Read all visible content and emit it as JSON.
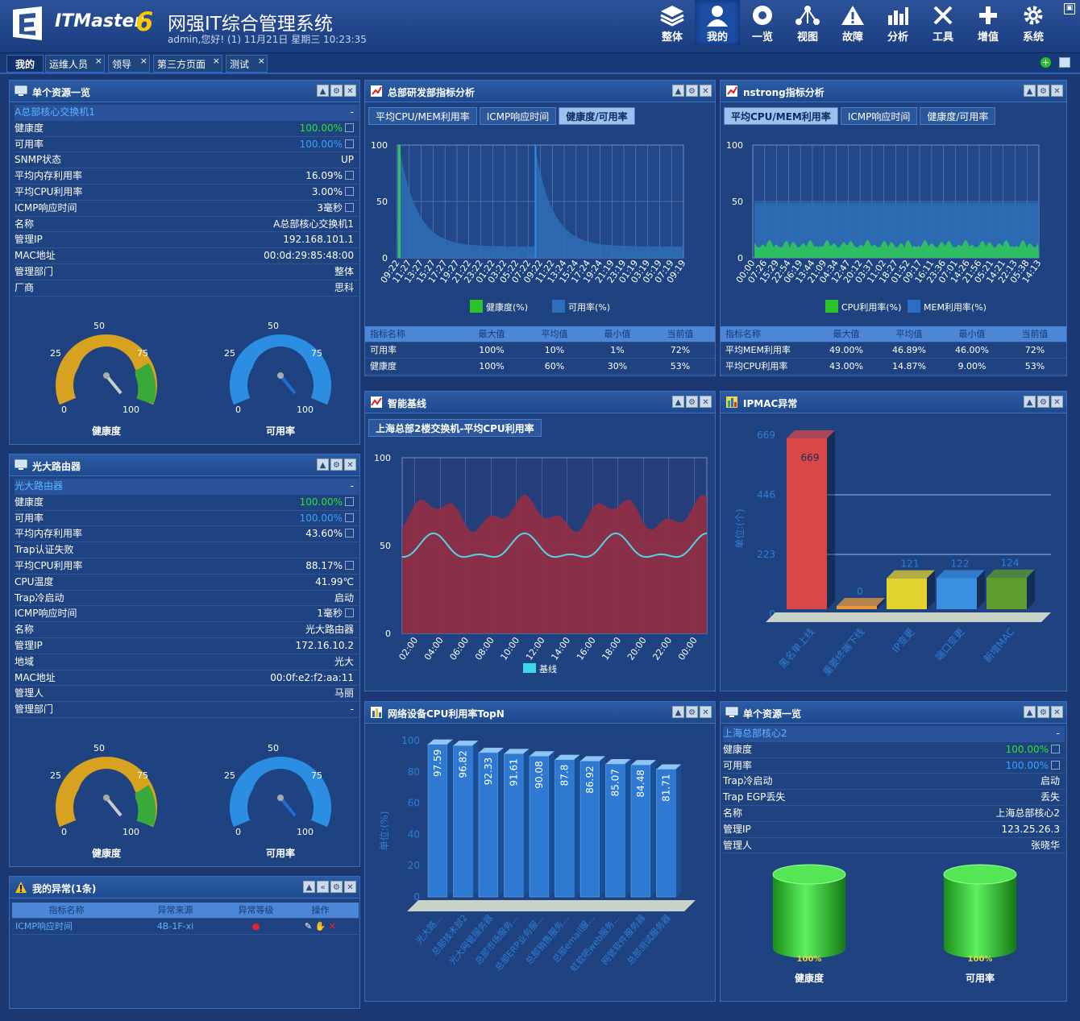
{
  "header": {
    "logo_text": "ITMaster",
    "logo_version": "6",
    "title": "网强IT综合管理系统",
    "user_info": "admin,您好! (1) 11月21日 星期三 10:23:35",
    "nav": [
      {
        "label": "整体",
        "icon": "layers-icon"
      },
      {
        "label": "我的",
        "icon": "user-icon"
      },
      {
        "label": "一览",
        "icon": "overview-icon"
      },
      {
        "label": "视图",
        "icon": "topology-icon"
      },
      {
        "label": "故障",
        "icon": "warning-icon"
      },
      {
        "label": "分析",
        "icon": "chart-icon"
      },
      {
        "label": "工具",
        "icon": "tools-icon"
      },
      {
        "label": "增值",
        "icon": "plus-icon"
      },
      {
        "label": "系统",
        "icon": "gear-icon"
      }
    ]
  },
  "tabs": [
    {
      "label": "我的",
      "active": true
    },
    {
      "label": "运维人员"
    },
    {
      "label": "领导"
    },
    {
      "label": "第三方页面"
    },
    {
      "label": "测试"
    }
  ],
  "panel1": {
    "title": "单个资源一览",
    "device": "A总部核心交换机1",
    "device_val": "-",
    "rows": [
      [
        "健康度",
        "100.00%"
      ],
      [
        "可用率",
        "100.00%"
      ],
      [
        "SNMP状态",
        "UP"
      ],
      [
        "平均内存利用率",
        "16.09%"
      ],
      [
        "平均CPU利用率",
        "3.00%"
      ],
      [
        "ICMP响应时间",
        "3毫秒"
      ],
      [
        "名称",
        "A总部核心交换机1"
      ],
      [
        "管理IP",
        "192.168.101.1"
      ],
      [
        "MAC地址",
        "00:0d:29:85:48:00"
      ],
      [
        "管理部门",
        "整体"
      ],
      [
        "厂商",
        "思科"
      ]
    ],
    "g1_label": "健康度",
    "g2_label": "可用率"
  },
  "panel2": {
    "title": "光大路由器",
    "device": "光大路由器",
    "device_val": "-",
    "rows": [
      [
        "健康度",
        "100.00%"
      ],
      [
        "可用率",
        "100.00%"
      ],
      [
        "平均内存利用率",
        "43.60%"
      ],
      [
        "Trap认证失败",
        ""
      ],
      [
        "平均CPU利用率",
        "88.17%"
      ],
      [
        "CPU温度",
        "41.99℃"
      ],
      [
        "Trap冷启动",
        "启动"
      ],
      [
        "ICMP响应时间",
        "1毫秒"
      ],
      [
        "名称",
        "光大路由器"
      ],
      [
        "管理IP",
        "172.16.10.2"
      ],
      [
        "地域",
        "光大"
      ],
      [
        "MAC地址",
        "00:0f:e2:f2:aa:11"
      ],
      [
        "管理人",
        "马丽"
      ],
      [
        "管理部门",
        "-"
      ]
    ],
    "g1_label": "健康度",
    "g2_label": "可用率"
  },
  "gauge_ticks": [
    "0",
    "25",
    "50",
    "75",
    "100"
  ],
  "panel3": {
    "title": "我的异常(1条)",
    "cols": [
      "指标名称",
      "异常来源",
      "异常等级",
      "操作"
    ],
    "row": [
      "ICMP响应时间",
      "4B-1F-xi"
    ]
  },
  "panel4": {
    "title": "总部研发部指标分析",
    "tabs": [
      "平均CPU/MEM利用率",
      "ICMP响应时间",
      "健康度/可用率"
    ],
    "x_labels": [
      "09:22",
      "11:27",
      "13:27",
      "15:27",
      "17:27",
      "19:27",
      "21:22",
      "23:22",
      "01:22",
      "03:22",
      "05:22",
      "07:22",
      "09:22",
      "11:22",
      "13:24",
      "15:24",
      "17:24",
      "19:24",
      "21:19",
      "23:19",
      "01:19",
      "03:19",
      "05:19",
      "07:19",
      "09:19"
    ],
    "y_ticks": [
      "100",
      "50",
      "0"
    ],
    "legend": [
      "健康度(%)",
      "可用率(%)"
    ],
    "cols": [
      "指标名称",
      "最大值",
      "平均值",
      "最小值",
      "当前值"
    ],
    "rows": [
      [
        "可用率",
        "100%",
        "10%",
        "1%",
        "72%"
      ],
      [
        "健康度",
        "100%",
        "60%",
        "30%",
        "53%"
      ]
    ]
  },
  "panel5": {
    "title": "nstrong指标分析",
    "tabs": [
      "平均CPU/MEM利用率",
      "ICMP响应时间",
      "健康度/可用率"
    ],
    "x_labels": [
      "00:00",
      "07:26",
      "15:29",
      "22:54",
      "06:19",
      "13:44",
      "21:09",
      "04:34",
      "12:47",
      "20:12",
      "03:37",
      "11:02",
      "18:27",
      "01:52",
      "09:17",
      "16:11",
      "23:36",
      "07:01",
      "14:26",
      "21:56",
      "05:21",
      "14:21",
      "22:13",
      "05:38",
      "14:13"
    ],
    "y_ticks": [
      "100",
      "50",
      "0"
    ],
    "legend": [
      "CPU利用率(%)",
      "MEM利用率(%)"
    ],
    "cols": [
      "指标名称",
      "最大值",
      "平均值",
      "最小值",
      "当前值"
    ],
    "rows": [
      [
        "平均MEM利用率",
        "49.00%",
        "46.89%",
        "46.00%",
        "72%"
      ],
      [
        "平均CPU利用率",
        "43.00%",
        "14.87%",
        "9.00%",
        "53%"
      ]
    ]
  },
  "panel6": {
    "title": "智能基线",
    "tab": "上海总部2楼交换机-平均CPU利用率",
    "x_labels": [
      "02:00",
      "04:00",
      "06:00",
      "08:00",
      "10:00",
      "12:00",
      "14:00",
      "16:00",
      "18:00",
      "20:00",
      "22:00",
      "00:00"
    ],
    "y_ticks": [
      "100",
      "50",
      "0"
    ],
    "legend": "基线"
  },
  "panel7": {
    "title": "IPMAC异常",
    "ylabel": "单位:(个)",
    "y_ticks": [
      "669",
      "446",
      "223",
      "0"
    ],
    "categories": [
      "黑名单上线",
      "重要终端下线",
      "IP变更",
      "端口变更",
      "新增MAC"
    ],
    "values": [
      669,
      0,
      121,
      122,
      124
    ],
    "colors": [
      "#d84848",
      "#e89a3a",
      "#e2d22d",
      "#3a8fe0",
      "#5d9c2d"
    ]
  },
  "panel8": {
    "title": "网络设备CPU利用率TopN",
    "ylabel": "单位:(%)",
    "y_ticks": [
      "100",
      "80",
      "60",
      "40",
      "20",
      "0"
    ],
    "categories": [
      "光大路...",
      "总部技术部2",
      "光大网管服务器",
      "总部市场服务...",
      "总部ERP业务服...",
      "总部销售服务...",
      "总部email服...",
      "虹软吧web服务...",
      "网管软件服务器",
      "总部测试服务器"
    ],
    "values": [
      97.59,
      96.82,
      92.33,
      91.61,
      90.08,
      87.8,
      86.92,
      85.07,
      84.48,
      81.71
    ]
  },
  "panel9": {
    "title": "单个资源一览",
    "device": "上海总部核心2",
    "device_val": "-",
    "rows": [
      [
        "健康度",
        "100.00%"
      ],
      [
        "可用率",
        "100.00%"
      ],
      [
        "Trap冷启动",
        "启动"
      ],
      [
        "Trap EGP丢失",
        "丢失"
      ],
      [
        "名称",
        "上海总部核心2"
      ],
      [
        "管理IP",
        "123.25.26.3"
      ],
      [
        "管理人",
        "张晓华"
      ]
    ],
    "c1_pct": "100%",
    "c1_label": "健康度",
    "c2_pct": "100%",
    "c2_label": "可用率"
  },
  "chart_data": [
    {
      "type": "bar",
      "title": "IPMAC异常",
      "ylabel": "单位:(个)",
      "categories": [
        "黑名单上线",
        "重要终端下线",
        "IP变更",
        "端口变更",
        "新增MAC"
      ],
      "values": [
        669,
        0,
        121,
        122,
        124
      ]
    },
    {
      "type": "bar",
      "title": "网络设备CPU利用率TopN",
      "ylabel": "单位:(%)",
      "ylim": [
        0,
        100
      ],
      "categories": [
        "光大路...",
        "总部技术部2",
        "光大网管服务器",
        "总部市场服务...",
        "总部ERP业务服...",
        "总部销售服务...",
        "总部email服...",
        "虹软吧web服务...",
        "网管软件服务器",
        "总部测试服务器"
      ],
      "values": [
        97.59,
        96.82,
        92.33,
        91.61,
        90.08,
        87.8,
        86.92,
        85.07,
        84.48,
        81.71
      ]
    }
  ]
}
